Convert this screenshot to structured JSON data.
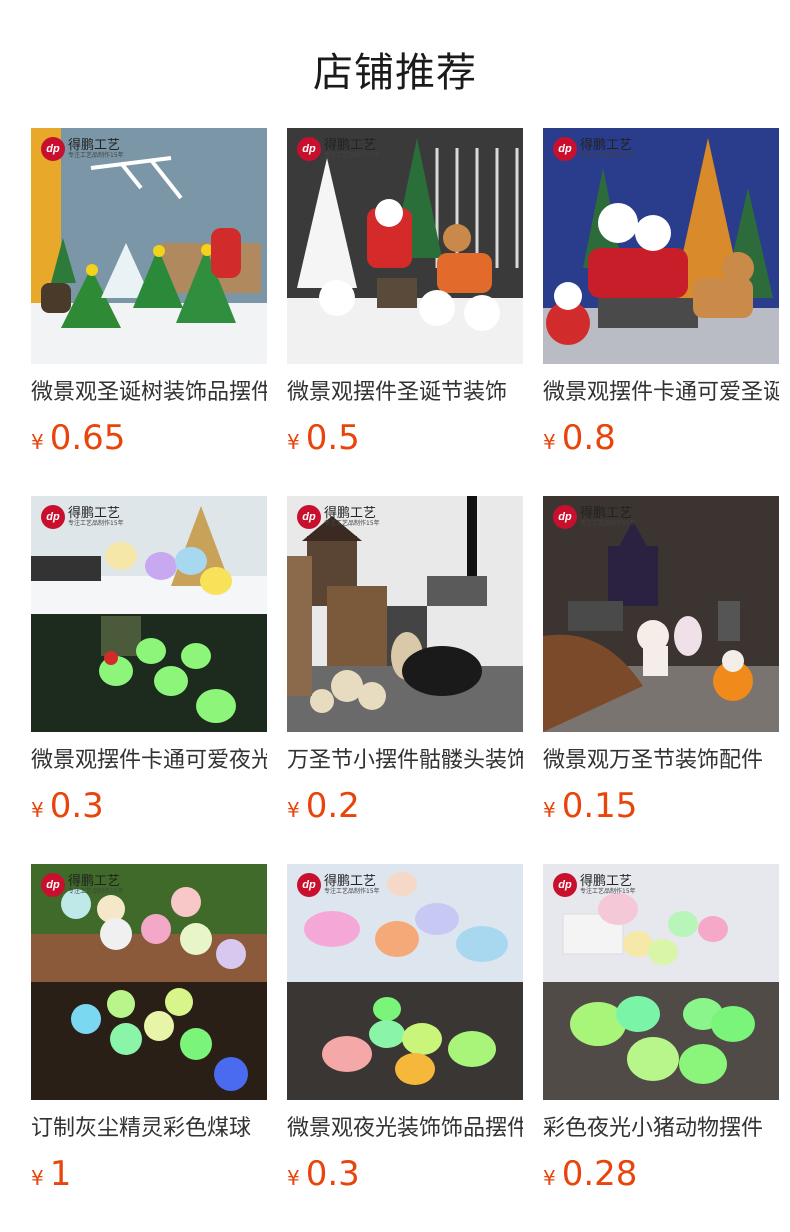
{
  "header": {
    "title": "店铺推荐"
  },
  "brand": {
    "logo": "dp",
    "name": "得鹏工艺",
    "sub": "专注工艺品制作15年"
  },
  "products": [
    {
      "name": "微景观圣诞树装饰品摆件",
      "currency": "¥",
      "price": "0.65"
    },
    {
      "name": "微景观摆件圣诞节装饰",
      "currency": "¥",
      "price": "0.5"
    },
    {
      "name": "微景观摆件卡通可爱圣诞",
      "currency": "¥",
      "price": "0.8"
    },
    {
      "name": "微景观摆件卡通可爱夜光",
      "currency": "¥",
      "price": "0.3"
    },
    {
      "name": "万圣节小摆件骷髅头装饰",
      "currency": "¥",
      "price": "0.2"
    },
    {
      "name": "微景观万圣节装饰配件",
      "currency": "¥",
      "price": "0.15"
    },
    {
      "name": "订制灰尘精灵彩色煤球",
      "currency": "¥",
      "price": "1"
    },
    {
      "name": "微景观夜光装饰饰品摆件",
      "currency": "¥",
      "price": "0.3"
    },
    {
      "name": "彩色夜光小猪动物摆件",
      "currency": "¥",
      "price": "0.28"
    }
  ]
}
